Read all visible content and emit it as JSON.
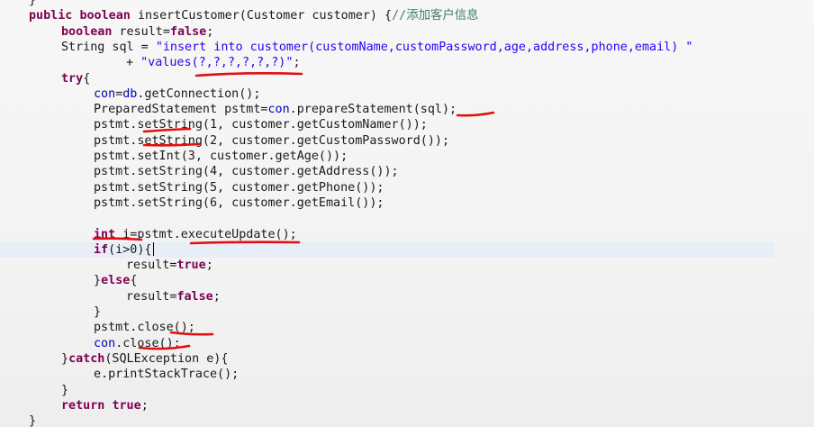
{
  "editor": {
    "language": "java",
    "colors": {
      "keyword": "#7f0055",
      "string": "#2a00ff",
      "comment": "#3f7f5f",
      "field": "#0000c0",
      "annotation_pen": "#e01010",
      "current_line": "#e8eef7"
    },
    "lines": [
      {
        "indent": 0,
        "segs": [
          [
            "p",
            "}"
          ]
        ]
      },
      {
        "indent": 0,
        "segs": [
          [
            "k",
            "public"
          ],
          [
            "p",
            " "
          ],
          [
            "k",
            "boolean"
          ],
          [
            "p",
            " insertCustomer(Customer customer) {"
          ],
          [
            "c",
            "//添加客户信息"
          ]
        ]
      },
      {
        "indent": 1,
        "segs": [
          [
            "k",
            "boolean"
          ],
          [
            "p",
            " result="
          ],
          [
            "k",
            "false"
          ],
          [
            "p",
            ";"
          ]
        ]
      },
      {
        "indent": 1,
        "segs": [
          [
            "p",
            "String sql = "
          ],
          [
            "s",
            "\"insert into customer(customName,customPassword,age,address,phone,email) \""
          ]
        ]
      },
      {
        "indent": 3,
        "segs": [
          [
            "p",
            "+ "
          ],
          [
            "s",
            "\"values(?,?,?,?,?,?)\""
          ],
          [
            "p",
            ";"
          ]
        ]
      },
      {
        "indent": 1,
        "segs": [
          [
            "k",
            "try"
          ],
          [
            "p",
            "{"
          ]
        ]
      },
      {
        "indent": 2,
        "segs": [
          [
            "f",
            "con"
          ],
          [
            "p",
            "="
          ],
          [
            "f",
            "db"
          ],
          [
            "p",
            ".getConnection();"
          ]
        ]
      },
      {
        "indent": 2,
        "segs": [
          [
            "p",
            "PreparedStatement pstmt="
          ],
          [
            "f",
            "con"
          ],
          [
            "p",
            ".prepareStatement(sql);"
          ]
        ]
      },
      {
        "indent": 2,
        "segs": [
          [
            "p",
            "pstmt.setString(1, customer.getCustomNamer());"
          ]
        ]
      },
      {
        "indent": 2,
        "segs": [
          [
            "p",
            "pstmt.setString(2, customer.getCustomPassword());"
          ]
        ]
      },
      {
        "indent": 2,
        "segs": [
          [
            "p",
            "pstmt.setInt(3, customer.getAge());"
          ]
        ]
      },
      {
        "indent": 2,
        "segs": [
          [
            "p",
            "pstmt.setString(4, customer.getAddress());"
          ]
        ]
      },
      {
        "indent": 2,
        "segs": [
          [
            "p",
            "pstmt.setString(5, customer.getPhone());"
          ]
        ]
      },
      {
        "indent": 2,
        "segs": [
          [
            "p",
            "pstmt.setString(6, customer.getEmail());"
          ]
        ]
      },
      {
        "indent": 0,
        "segs": []
      },
      {
        "indent": 2,
        "segs": [
          [
            "k",
            "int"
          ],
          [
            "p",
            " i=pstmt.executeUpdate();"
          ]
        ]
      },
      {
        "indent": 2,
        "current": true,
        "segs": [
          [
            "k",
            "if"
          ],
          [
            "p",
            "(i>0){"
          ]
        ]
      },
      {
        "indent": 3,
        "segs": [
          [
            "p",
            "result="
          ],
          [
            "k",
            "true"
          ],
          [
            "p",
            ";"
          ]
        ]
      },
      {
        "indent": 2,
        "segs": [
          [
            "p",
            "}"
          ],
          [
            "k",
            "else"
          ],
          [
            "p",
            "{"
          ]
        ]
      },
      {
        "indent": 3,
        "segs": [
          [
            "p",
            "result="
          ],
          [
            "k",
            "false"
          ],
          [
            "p",
            ";"
          ]
        ]
      },
      {
        "indent": 2,
        "segs": [
          [
            "p",
            "}"
          ]
        ]
      },
      {
        "indent": 2,
        "segs": [
          [
            "p",
            "pstmt.close();"
          ]
        ]
      },
      {
        "indent": 2,
        "segs": [
          [
            "f",
            "con"
          ],
          [
            "p",
            ".close();"
          ]
        ]
      },
      {
        "indent": 1,
        "segs": [
          [
            "p",
            "}"
          ],
          [
            "k",
            "catch"
          ],
          [
            "p",
            "(SQLException e){"
          ]
        ]
      },
      {
        "indent": 2,
        "segs": [
          [
            "p",
            "e.printStackTrace();"
          ]
        ]
      },
      {
        "indent": 1,
        "segs": [
          [
            "p",
            "}"
          ]
        ]
      },
      {
        "indent": 1,
        "segs": [
          [
            "k",
            "return"
          ],
          [
            "p",
            " "
          ],
          [
            "k",
            "true"
          ],
          [
            "p",
            ";"
          ]
        ]
      },
      {
        "indent": 0,
        "segs": [
          [
            "p",
            "}"
          ]
        ]
      }
    ]
  }
}
